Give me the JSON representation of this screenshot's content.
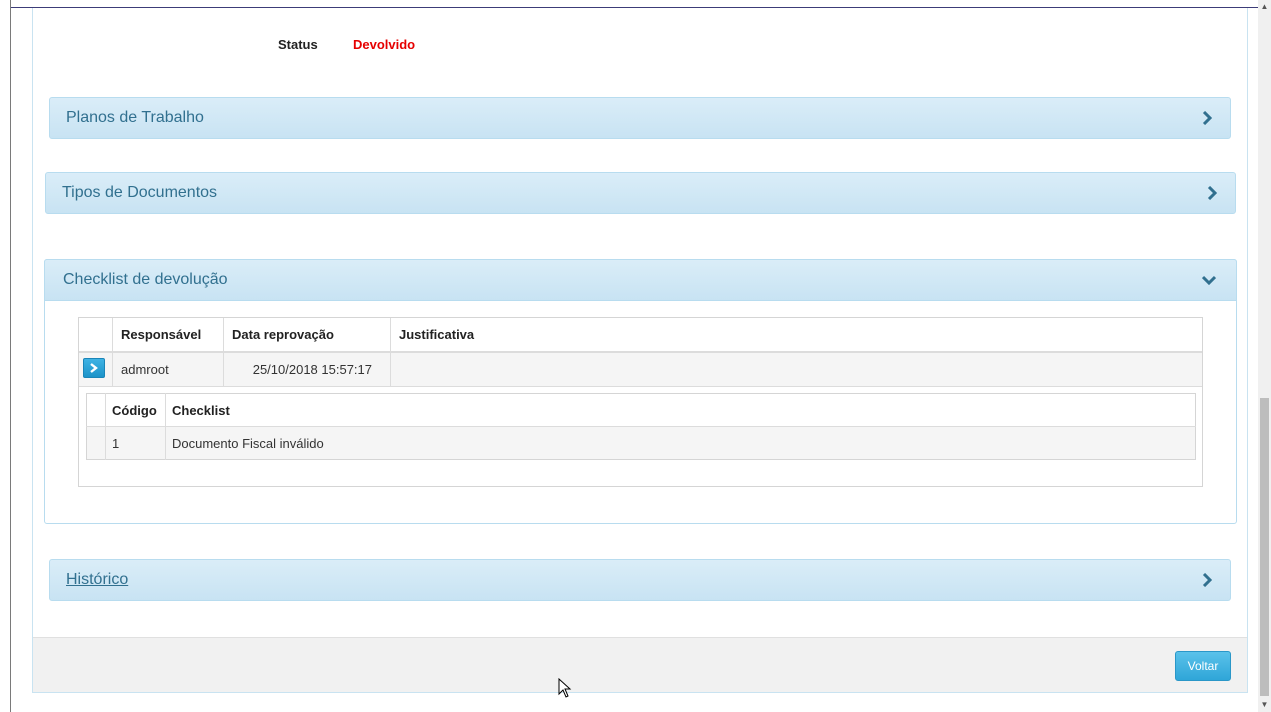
{
  "status": {
    "label": "Status",
    "value": "Devolvido",
    "value_color": "#e60000"
  },
  "panels": {
    "planos": {
      "title": "Planos de Trabalho",
      "icon": "chevron-right-icon"
    },
    "tipos": {
      "title": "Tipos de Documentos",
      "icon": "chevron-right-icon"
    },
    "checklist": {
      "title": "Checklist de devolução",
      "icon": "chevron-down-icon"
    },
    "historico": {
      "title": "Histórico",
      "icon": "chevron-right-icon"
    }
  },
  "devolucoes": {
    "headers": [
      "",
      "Responsável",
      "Data reprovação",
      "Justificativa"
    ],
    "rows": [
      {
        "responsavel": "admroot",
        "data": "25/10/2018 15:57:17",
        "justificativa": ""
      }
    ]
  },
  "checklist_items": {
    "headers": [
      "",
      "Código",
      "Checklist"
    ],
    "rows": [
      {
        "codigo": "1",
        "checklist": "Documento Fiscal inválido"
      }
    ]
  },
  "footer": {
    "voltar_label": "Voltar"
  },
  "colors": {
    "accent": "#31708f",
    "panel_bg": "#d4eaf7",
    "button": "#3ab0e0"
  }
}
